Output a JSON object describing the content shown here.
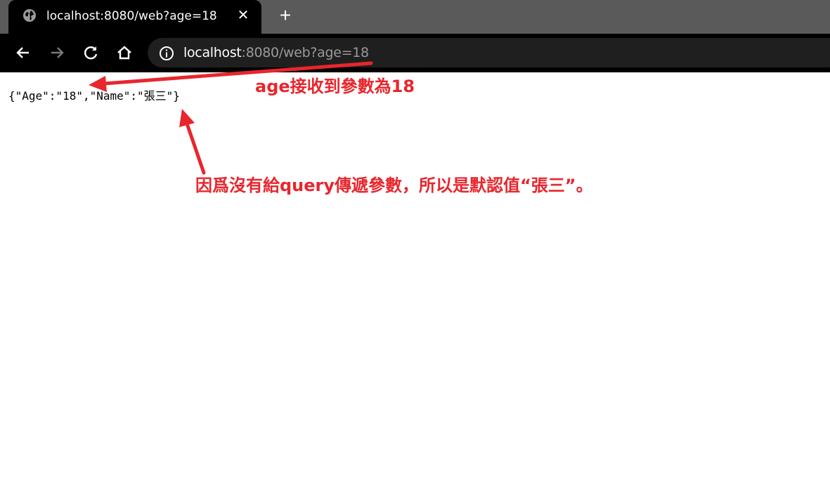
{
  "browser": {
    "tab": {
      "title": "localhost:8080/web?age=18",
      "favicon": "globe-icon"
    },
    "new_tab_icon": "plus-icon",
    "nav": {
      "back": "arrow-left-icon",
      "forward": "arrow-right-icon",
      "reload": "reload-icon",
      "home": "home-icon"
    },
    "address_bar": {
      "host": "localhost",
      "rest": ":8080/web?age=18",
      "icon": "info-icon"
    }
  },
  "page": {
    "json_text": "{\"Age\":\"18\",\"Name\":\"張三\"}"
  },
  "annotations": {
    "age_note": "age接收到參數為18",
    "name_note": "因爲沒有給query傳遞參數，所以是默認值“張三”。",
    "color": "#e8262d"
  }
}
